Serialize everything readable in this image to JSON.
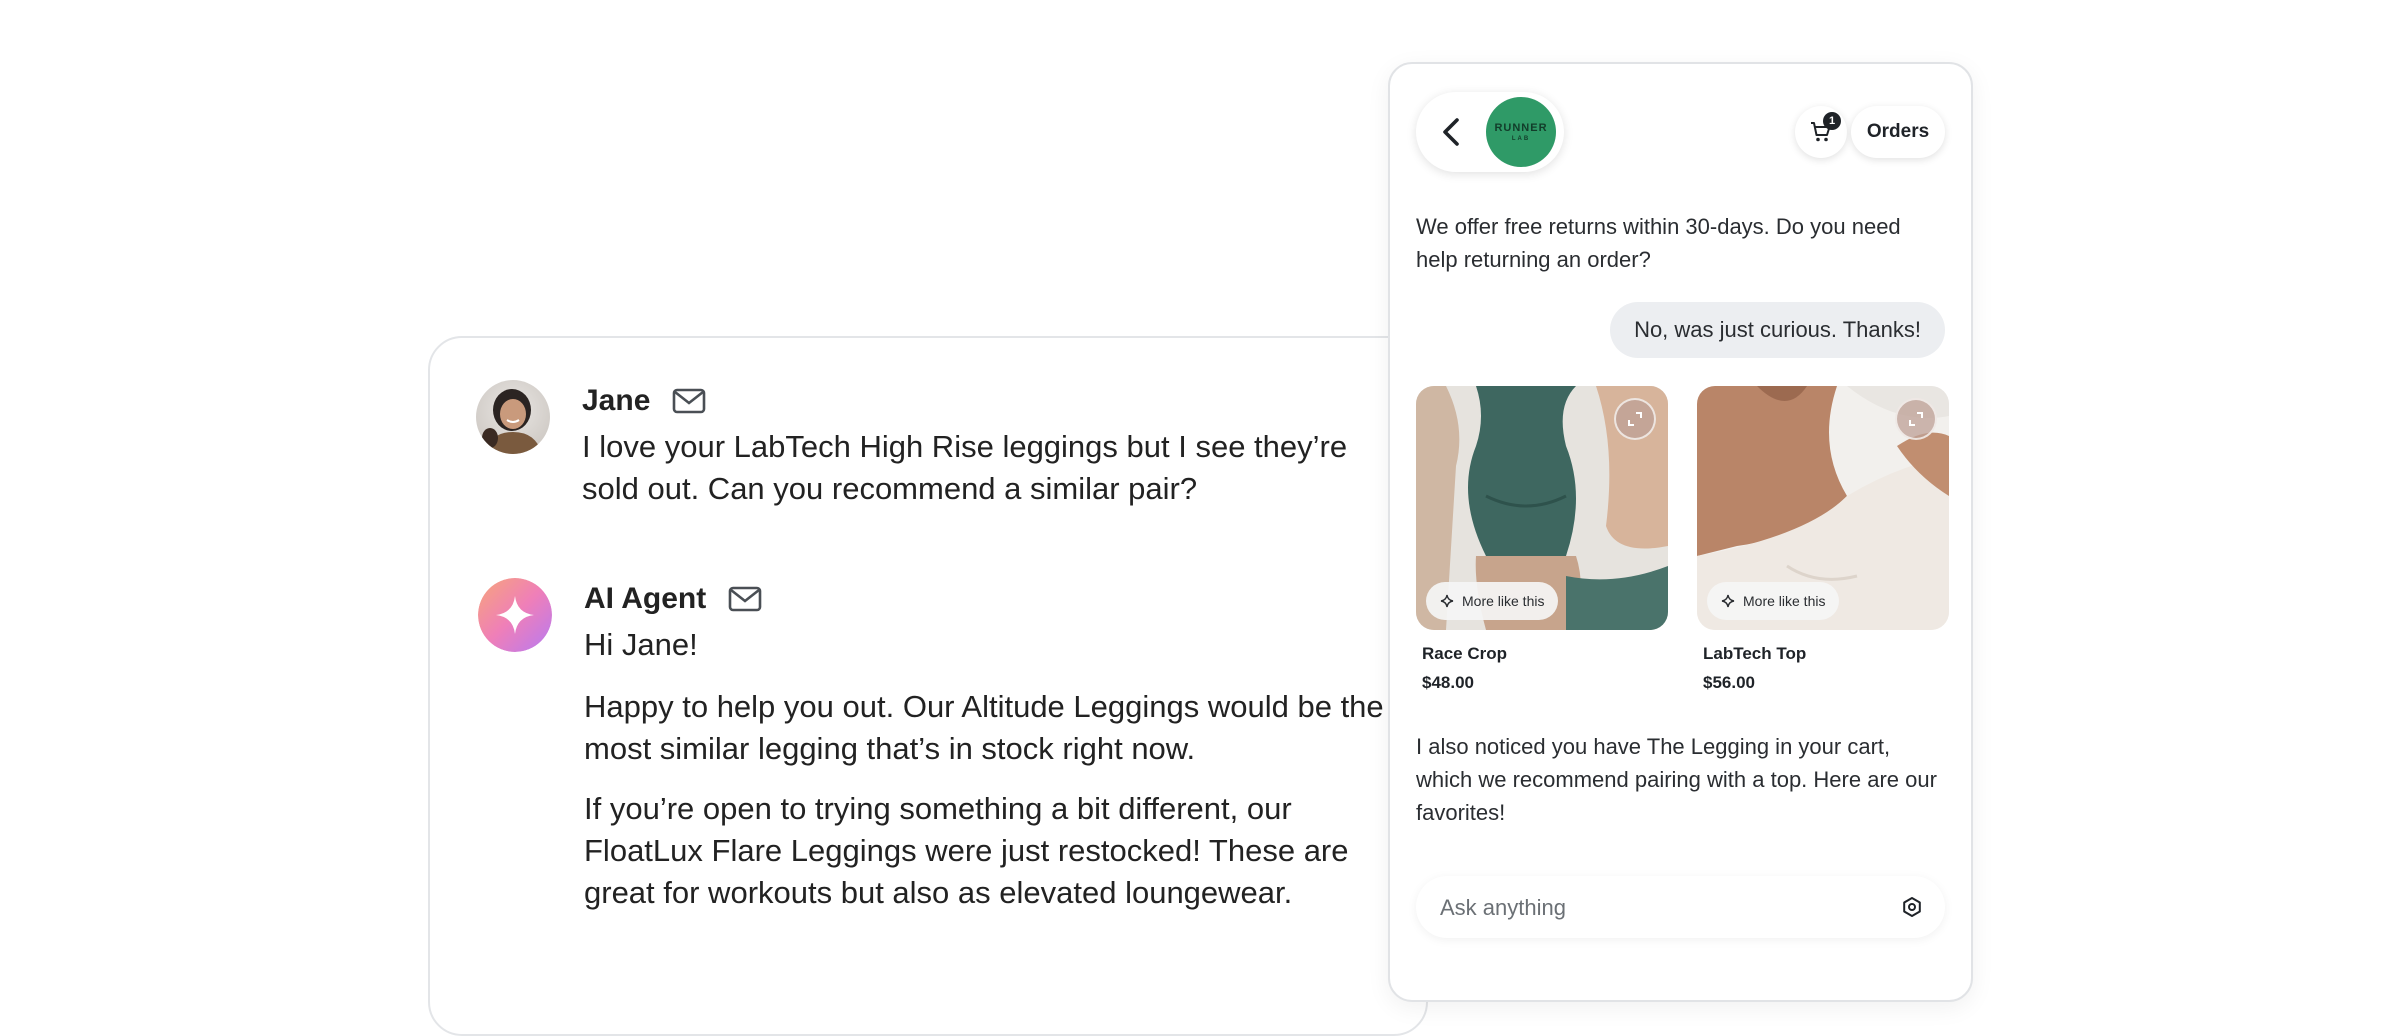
{
  "thread": {
    "messages": [
      {
        "sender": "Jane",
        "paragraphs": [
          "I love your LabTech High Rise leggings but I see they’re sold out. Can you recommend a similar pair?"
        ]
      },
      {
        "sender": "AI Agent",
        "paragraphs": [
          "Hi Jane!",
          "Happy to help you out. Our Altitude Leggings would be the most similar legging that’s in stock right now.",
          "If you’re open to trying something a bit different, our FloatLux Flare Leggings were just restocked! These are great for workouts but also as elevated loungewear."
        ]
      }
    ]
  },
  "widget": {
    "logo": {
      "line1": "RUNNER",
      "line2": "LAB"
    },
    "cart_count": "1",
    "orders_label": "Orders",
    "bot_message_1": "We offer free returns within 30-days. Do you need help returning an order?",
    "user_message": "No, was just curious. Thanks!",
    "products": [
      {
        "name": "Race Crop",
        "price": "$48.00",
        "more_label": "More like this"
      },
      {
        "name": "LabTech Top",
        "price": "$56.00",
        "more_label": "More like this"
      }
    ],
    "bot_message_2": "I also noticed you have The Legging in your cart, which we recommend pairing with a top. Here are our favorites!",
    "input": {
      "placeholder": "Ask anything",
      "value": ""
    }
  },
  "colors": {
    "logo_green": "#2f9a67",
    "user_bubble": "#eceef1",
    "agent_gradient_start": "#f59a7a",
    "agent_gradient_end": "#c27af0"
  },
  "icons": [
    "mail-icon",
    "chevron-left-icon",
    "cart-icon",
    "expand-icon",
    "sparkle-icon",
    "settings-icon"
  ]
}
